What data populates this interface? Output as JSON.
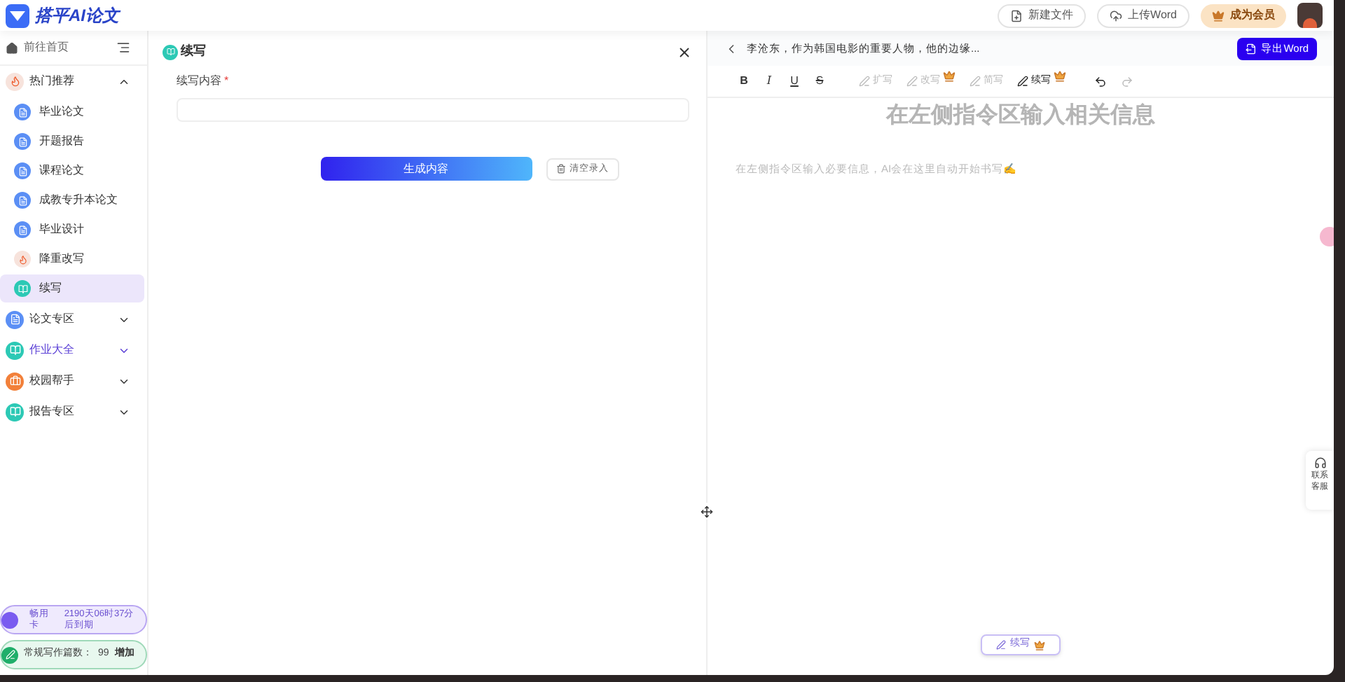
{
  "header": {
    "logo_text": "搭平AI论文",
    "actions": [
      {
        "label": "新建文件",
        "kind": "file"
      },
      {
        "label": "上传Word",
        "kind": "upload"
      },
      {
        "label": "成为会员",
        "kind": "vip"
      }
    ]
  },
  "sidebar": {
    "home": "前往首页",
    "groups": [
      {
        "label": "热门推荐",
        "kind": "fire",
        "expanded": true,
        "selected": false,
        "children": [
          {
            "label": "毕业论文",
            "kind": "doc",
            "selected": false
          },
          {
            "label": "开题报告",
            "kind": "doc",
            "selected": false
          },
          {
            "label": "课程论文",
            "kind": "doc",
            "selected": false
          },
          {
            "label": "成教专升本论文",
            "kind": "doc",
            "selected": false
          },
          {
            "label": "毕业设计",
            "kind": "doc",
            "selected": false
          },
          {
            "label": "降重改写",
            "kind": "fire",
            "selected": false
          },
          {
            "label": "续写",
            "kind": "teal",
            "selected": true
          }
        ]
      },
      {
        "label": "论文专区",
        "kind": "doc",
        "expanded": false,
        "selected": false
      },
      {
        "label": "作业大全",
        "kind": "teal",
        "expanded": false,
        "selected": true
      },
      {
        "label": "校园帮手",
        "kind": "orange",
        "expanded": false,
        "selected": false
      },
      {
        "label": "报告专区",
        "kind": "teal",
        "expanded": false,
        "selected": false
      }
    ],
    "card": {
      "name": "畅用卡",
      "expiry": "2190天06时37分后到期"
    },
    "quota": {
      "label": "常规写作篇数：",
      "count": "99",
      "action": "增加"
    }
  },
  "form": {
    "title": "续写",
    "field_label": "续写内容",
    "required_mark": "*",
    "submit": "生成内容",
    "clear": "清空录入"
  },
  "editor": {
    "doc_title": "李沧东，作为韩国电影的重要人物，他的边缘...",
    "export": "导出Word",
    "tools": [
      {
        "kind": "bold",
        "label": "B"
      },
      {
        "kind": "italic",
        "label": "I"
      },
      {
        "kind": "underline",
        "label": "U"
      },
      {
        "kind": "strike",
        "label": "S"
      },
      {
        "kind": "ai",
        "label": "扩写",
        "disabled": true,
        "premium": false
      },
      {
        "kind": "ai",
        "label": "改写",
        "disabled": true,
        "premium": true
      },
      {
        "kind": "ai",
        "label": "简写",
        "disabled": true,
        "premium": false
      },
      {
        "kind": "ai",
        "label": "续写",
        "disabled": false,
        "premium": true
      },
      {
        "kind": "undo",
        "disabled": false
      },
      {
        "kind": "redo",
        "disabled": true
      }
    ],
    "heading": "在左侧指令区输入相关信息",
    "hint": "在左侧指令区输入必要信息，AI会在这里自动开始书写✍",
    "float_action": "续写"
  },
  "support": {
    "line1": "联系",
    "line2": "客服"
  }
}
